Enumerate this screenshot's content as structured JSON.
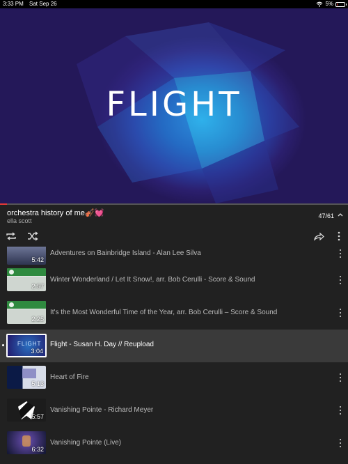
{
  "status": {
    "time": "3:33 PM",
    "date": "Sat Sep 26",
    "battery": "5%",
    "battery_level": 0.05
  },
  "video": {
    "title_text": "FLIGHT",
    "progress": 0.02
  },
  "playlist": {
    "title": "orchestra history of me🎻💓",
    "owner": "ella scott",
    "position": "47/61",
    "items": [
      {
        "title": "Adventures on Bainbridge Island - Alan Lee Silva",
        "duration": "5:42",
        "thumb": "water"
      },
      {
        "title": "Winter Wonderland / Let It Snow!, arr. Bob Cerulli - Score & Sound",
        "duration": "2:57",
        "thumb": "green"
      },
      {
        "title": "It's the Most Wonderful Time of the Year, arr. Bob Cerulli – Score & Sound",
        "duration": "2:25",
        "thumb": "green"
      },
      {
        "title": "Flight - Susan H. Day // Reupload",
        "duration": "3:04",
        "thumb": "flight",
        "active": true,
        "thumb_text": "FLIGHT"
      },
      {
        "title": "Heart of Fire",
        "duration": "5:13",
        "thumb": "fire"
      },
      {
        "title": "Vanishing Pointe - Richard Meyer",
        "duration": "5:57",
        "thumb": "wolf"
      },
      {
        "title": "Vanishing Pointe (Live)",
        "duration": "6:32",
        "thumb": "live"
      }
    ]
  },
  "icons": {
    "wifi": "wifi-icon",
    "battery": "battery-icon",
    "repeat": "repeat-icon",
    "shuffle": "shuffle-icon",
    "share": "share-icon",
    "more": "more-vertical-icon",
    "collapse": "chevron-up-icon"
  },
  "colors": {
    "accent": "#e53935",
    "background": "#212121",
    "active_row": "#3a3a3a"
  }
}
